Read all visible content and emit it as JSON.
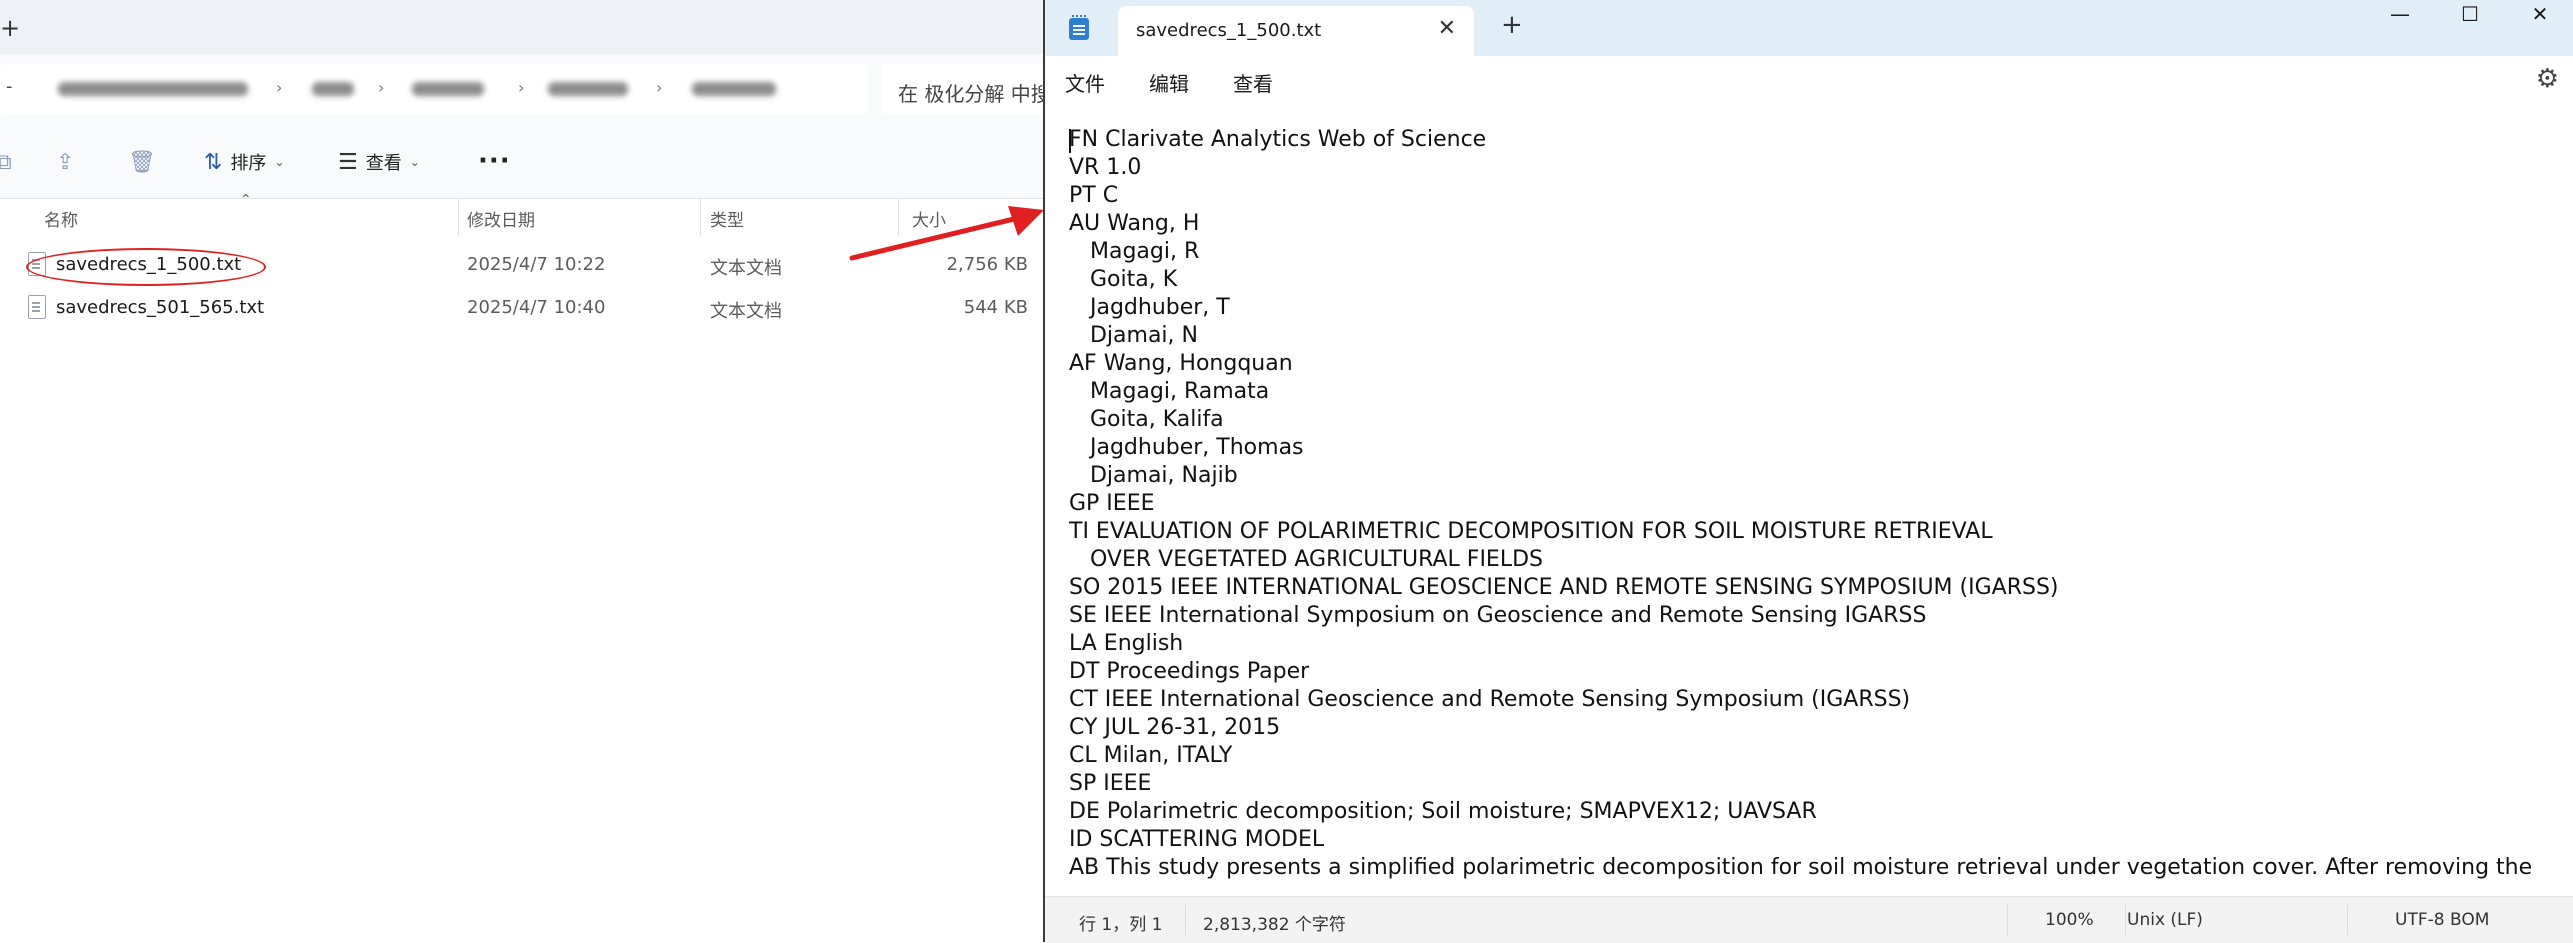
{
  "explorer": {
    "new_tab_glyph": "+",
    "search_placeholder": "在 极化分解 中搜",
    "toolbar": {
      "sort_label": "排序",
      "view_label": "查看",
      "more_label": "···"
    },
    "columns": {
      "name": "名称",
      "date": "修改日期",
      "type": "类型",
      "size": "大小"
    },
    "files": [
      {
        "name": "savedrecs_1_500.txt",
        "date": "2025/4/7 10:22",
        "type": "文本文档",
        "size": "2,756 KB"
      },
      {
        "name": "savedrecs_501_565.txt",
        "date": "2025/4/7 10:40",
        "type": "文本文档",
        "size": "544 KB"
      }
    ],
    "annotation_color": "#e02020"
  },
  "notepad": {
    "tab_title": "savedrecs_1_500.txt",
    "tab_close": "✕",
    "new_tab": "+",
    "window_controls": {
      "minimize": "—",
      "maximize": "☐",
      "close": "✕"
    },
    "menu": {
      "file": "文件",
      "edit": "编辑",
      "view": "查看"
    },
    "lines": [
      "FN Clarivate Analytics Web of Science",
      "VR 1.0",
      "PT C",
      "AU Wang, H",
      "   Magagi, R",
      "   Goita, K",
      "   Jagdhuber, T",
      "   Djamai, N",
      "AF Wang, Hongquan",
      "   Magagi, Ramata",
      "   Goita, Kalifa",
      "   Jagdhuber, Thomas",
      "   Djamai, Najib",
      "GP IEEE",
      "TI EVALUATION OF POLARIMETRIC DECOMPOSITION FOR SOIL MOISTURE RETRIEVAL",
      "   OVER VEGETATED AGRICULTURAL FIELDS",
      "SO 2015 IEEE INTERNATIONAL GEOSCIENCE AND REMOTE SENSING SYMPOSIUM (IGARSS)",
      "SE IEEE International Symposium on Geoscience and Remote Sensing IGARSS",
      "LA English",
      "DT Proceedings Paper",
      "CT IEEE International Geoscience and Remote Sensing Symposium (IGARSS)",
      "CY JUL 26-31, 2015",
      "CL Milan, ITALY",
      "SP IEEE",
      "DE Polarimetric decomposition; Soil moisture; SMAPVEX12; UAVSAR",
      "ID SCATTERING MODEL",
      "AB This study presents a simplified polarimetric decomposition for soil moisture retrieval under vegetation cover. After removing the"
    ],
    "status": {
      "position": "行 1，列 1",
      "chars": "2,813,382 个字符",
      "zoom": "100%",
      "line_ending": "Unix (LF)",
      "encoding": "UTF-8 BOM"
    },
    "accent_color": "#2f7fd1"
  }
}
